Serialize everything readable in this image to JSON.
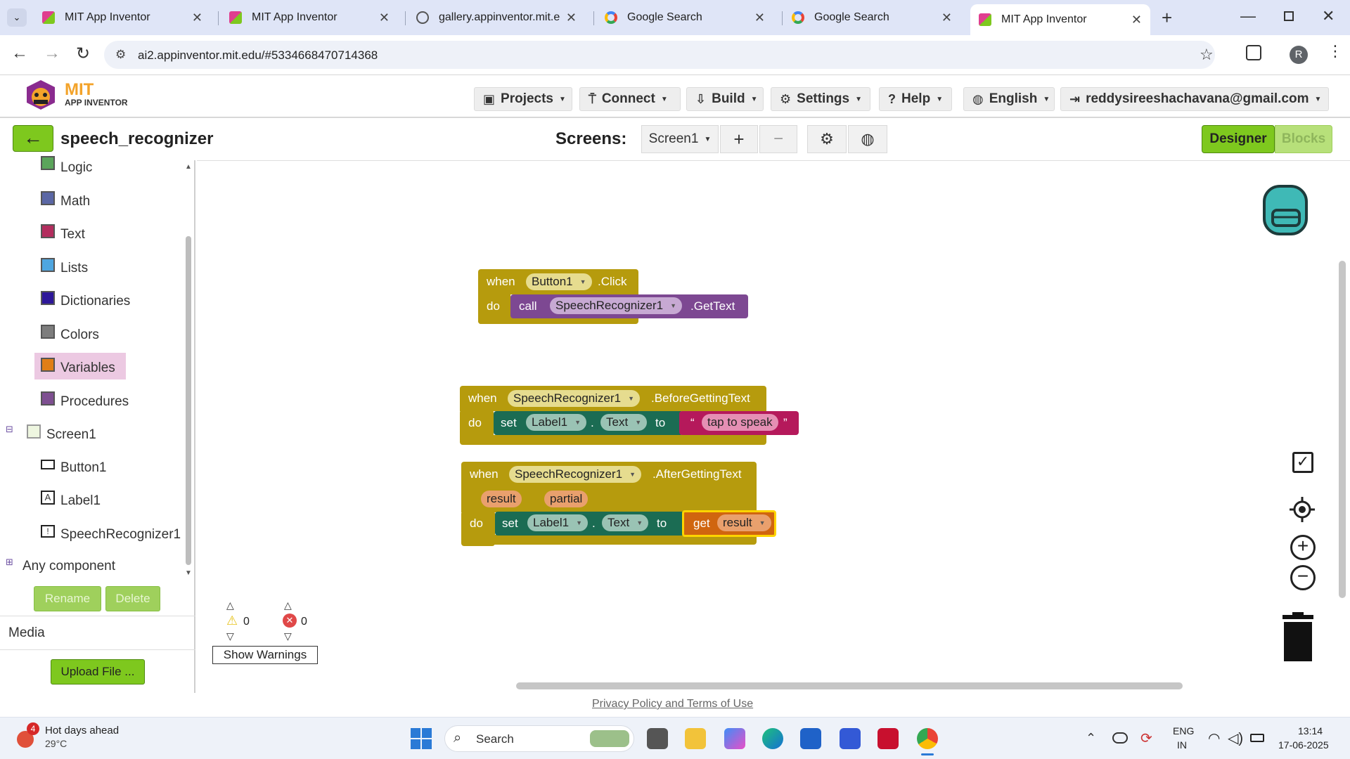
{
  "browser": {
    "tabs": [
      {
        "title": "MIT App Inventor",
        "active": false
      },
      {
        "title": "MIT App Inventor",
        "active": false
      },
      {
        "title": "gallery.appinventor.mit.edu",
        "active": false
      },
      {
        "title": "Google Search",
        "active": false
      },
      {
        "title": "Google Search",
        "active": false
      },
      {
        "title": "MIT App Inventor",
        "active": true
      }
    ],
    "url": "ai2.appinventor.mit.edu/#5334668470714368",
    "profile_initial": "R"
  },
  "header": {
    "logo_line1": "MIT",
    "logo_line2": "APP INVENTOR",
    "menu": [
      "Projects",
      "Connect",
      "Build",
      "Settings",
      "Help",
      "English"
    ],
    "account": "reddysireeshachavana@gmail.com"
  },
  "project": {
    "name": "speech_recognizer",
    "screens_label": "Screens:",
    "current_screen": "Screen1",
    "designer_label": "Designer",
    "blocks_label": "Blocks"
  },
  "sidebar": {
    "builtin": [
      {
        "label": "Logic",
        "color": "#5ba55b"
      },
      {
        "label": "Math",
        "color": "#5b67a5"
      },
      {
        "label": "Text",
        "color": "#b32d5e"
      },
      {
        "label": "Lists",
        "color": "#4ea6e0"
      },
      {
        "label": "Dictionaries",
        "color": "#2d1799"
      },
      {
        "label": "Colors",
        "color": "#7d7d7d"
      },
      {
        "label": "Variables",
        "color": "#e07e16"
      },
      {
        "label": "Procedures",
        "color": "#7e4f91"
      }
    ],
    "screen": "Screen1",
    "components": [
      "Button1",
      "Label1",
      "SpeechRecognizer1"
    ],
    "any_component": "Any component",
    "rename": "Rename",
    "delete": "Delete",
    "media": "Media",
    "upload": "Upload File ..."
  },
  "blocks": {
    "when": "when",
    "do": "do",
    "call": "call",
    "set": "set",
    "to": "to",
    "get": "get",
    "dot": ".",
    "b1_component": "Button1",
    "b1_event": ".Click",
    "b1_call_component": "SpeechRecognizer1",
    "b1_method": ".GetText",
    "b2_component": "SpeechRecognizer1",
    "b2_event": ".BeforeGettingText",
    "b2_target": "Label1",
    "b2_property": "Text",
    "b2_string": "tap to speak",
    "b3_component": "SpeechRecognizer1",
    "b3_event": ".AfterGettingText",
    "b3_param1": "result",
    "b3_param2": "partial",
    "b3_target": "Label1",
    "b3_property": "Text",
    "b3_get": "result",
    "quote_open": "“",
    "quote_close": "”"
  },
  "warnings": {
    "warning_count": "0",
    "error_count": "0",
    "show_warnings": "Show Warnings"
  },
  "footer": {
    "privacy": "Privacy Policy and Terms of Use"
  },
  "taskbar": {
    "weather_badge": "4",
    "weather_title": "Hot days ahead",
    "weather_temp": "29°C",
    "search": "Search",
    "lang1": "ENG",
    "lang2": "IN",
    "time": "13:14",
    "date": "17-06-2025"
  },
  "colors": {
    "ai_green": "#7ec81e",
    "event_block": "#b69b0d",
    "set_block": "#1b6c53",
    "call_block": "#7d4892",
    "text_block": "#b5195b",
    "get_block": "#d0650f"
  }
}
